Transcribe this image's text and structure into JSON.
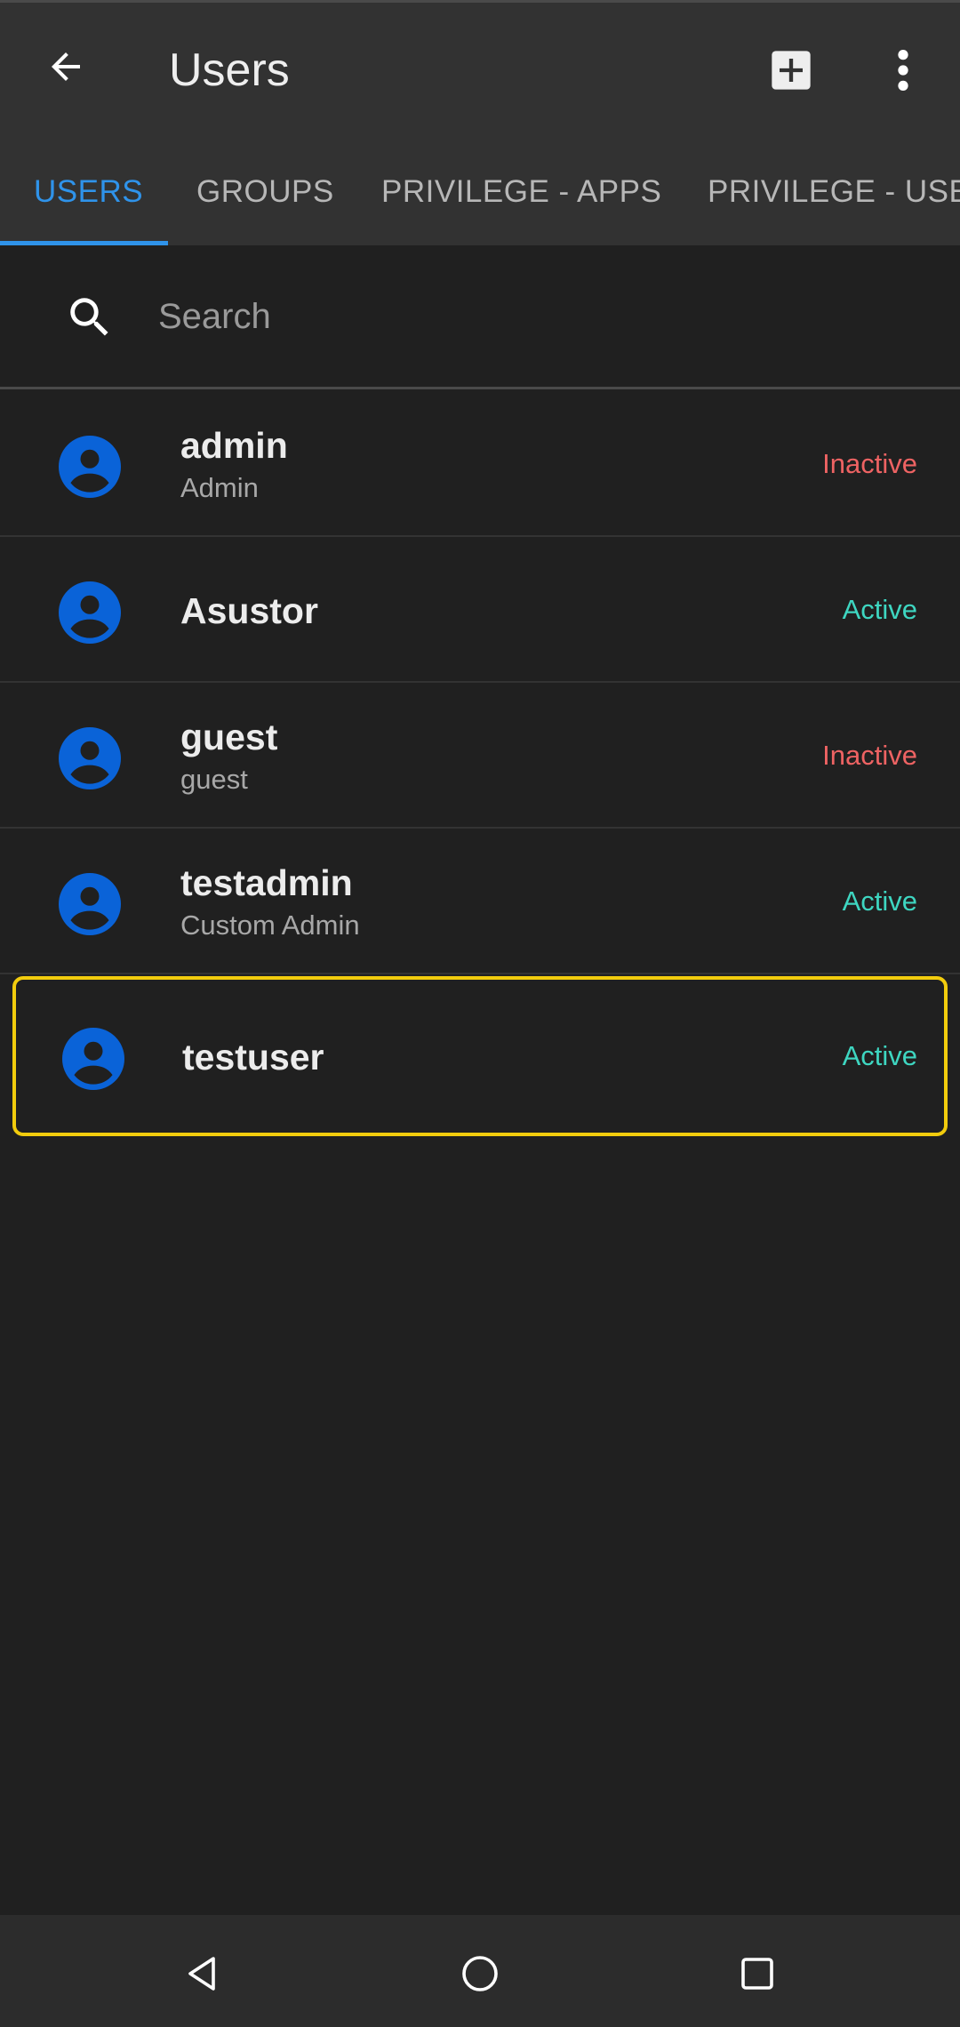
{
  "header": {
    "title": "Users",
    "back_icon": "arrow-left-icon",
    "add_icon": "add-box-icon",
    "more_icon": "more-vert-icon"
  },
  "tabs": [
    {
      "label": "USERS",
      "active": true
    },
    {
      "label": "GROUPS",
      "active": false
    },
    {
      "label": "PRIVILEGE - APPS",
      "active": false
    },
    {
      "label": "PRIVILEGE - USERS",
      "active": false
    }
  ],
  "search": {
    "placeholder": "Search",
    "value": ""
  },
  "users": [
    {
      "name": "admin",
      "description": "Admin",
      "status": "Inactive"
    },
    {
      "name": "Asustor",
      "description": "",
      "status": "Active"
    },
    {
      "name": "guest",
      "description": "guest",
      "status": "Inactive"
    },
    {
      "name": "testadmin",
      "description": "Custom Admin",
      "status": "Active"
    },
    {
      "name": "testuser",
      "description": "",
      "status": "Active",
      "highlighted": true
    }
  ],
  "colors": {
    "accent": "#2f93ea",
    "avatar": "#0a63d8",
    "inactive": "#ee6363",
    "active": "#3ed6c1",
    "highlight": "#f2cc0d"
  },
  "navigation_bar": {
    "icons": [
      "nav-back-icon",
      "nav-home-icon",
      "nav-recents-icon"
    ]
  }
}
